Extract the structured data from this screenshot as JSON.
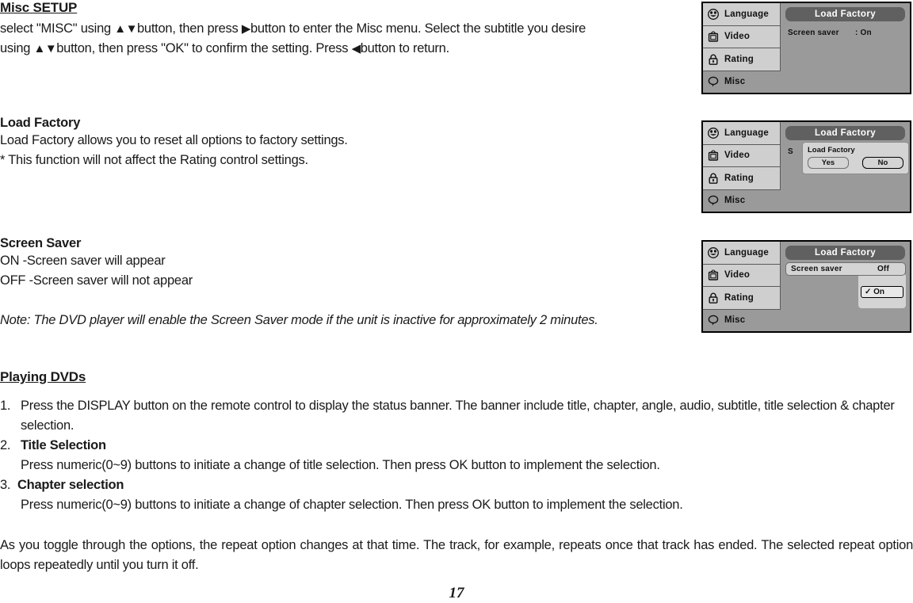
{
  "document": {
    "misc_setup": {
      "heading": "Misc SETUP",
      "line1_a": "select \"MISC\" using ",
      "line1_arrows": "▲▼",
      "line1_b": "button, then press ",
      "line1_arrow_right": "▶",
      "line1_c": "button to enter the Misc menu. Select the subtitle you desire",
      "line2_a": "using ",
      "line2_arrows": "▲▼",
      "line2_b": "button, then press \"OK\" to confirm the setting. Press ",
      "line2_arrow_left": "◀",
      "line2_c": "button to return."
    },
    "load_factory": {
      "heading": "Load Factory",
      "line1": "Load Factory allows you to reset all options to factory settings.",
      "line2": "* This function will not affect the Rating control settings."
    },
    "screen_saver": {
      "heading": "Screen Saver",
      "line1": "ON -Screen saver will appear",
      "line2": "OFF -Screen saver will not appear",
      "note": "Note: The DVD player will enable the Screen Saver mode if the unit is inactive for approximately 2 minutes."
    },
    "playing_dvds": {
      "heading": "Playing DVDs",
      "steps": [
        {
          "number": "1.",
          "title": "",
          "text": "Press the DISPLAY button on the remote control to display the status banner. The banner include title, chapter, angle, audio, subtitle, title selection & chapter selection."
        },
        {
          "number": "2.",
          "title": "Title Selection",
          "text": "Press numeric(0~9) buttons to initiate a change of title selection. Then press OK button to implement the selection."
        },
        {
          "number": "3.",
          "title": "Chapter selection",
          "text": "Press numeric(0~9) buttons to initiate a change of chapter selection. Then press OK button to implement the selection."
        }
      ]
    },
    "closing_paragraph": "As you toggle through the options, the repeat option changes at that time. The track, for example, repeats once that track has ended. The selected repeat option loops repeatedly until you turn it off.",
    "page_number": "17"
  },
  "osd": {
    "sidebar": [
      {
        "label": "Language",
        "icon": "smiley-face-icon",
        "selected": false
      },
      {
        "label": "Video",
        "icon": "television-icon",
        "selected": false
      },
      {
        "label": "Rating",
        "icon": "padlock-icon",
        "selected": false
      },
      {
        "label": "Misc",
        "icon": "speech-bubble-icon",
        "selected": true
      }
    ],
    "title": "Load Factory",
    "panel1": {
      "row_label": "Screen saver",
      "row_value": ": On"
    },
    "panel2": {
      "dialog_title": "Load Factory",
      "button_yes": "Yes",
      "button_no": "No",
      "hidden_row_label": "S"
    },
    "panel3": {
      "row_label": "Screen saver",
      "row_value": "Off",
      "option_on": "✓ On"
    },
    "colors": {
      "panel_background": "#9a9a9a",
      "sidebar_item": "#cfcfcf",
      "title_bar": "#606060",
      "title_text": "#ffffff",
      "dialog_background": "#d4d4d4",
      "border": "#000000"
    }
  }
}
